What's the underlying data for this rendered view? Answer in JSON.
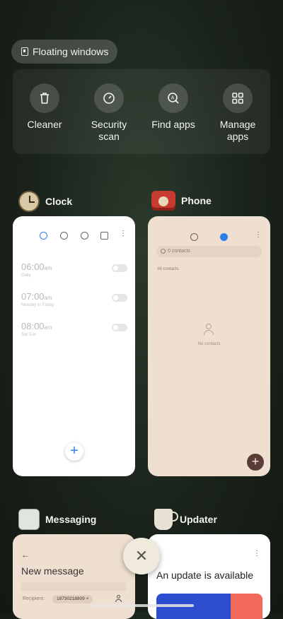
{
  "floating_windows": {
    "label": "Floating windows"
  },
  "quick_actions": [
    {
      "label": "Cleaner",
      "icon": "trash-icon"
    },
    {
      "label": "Security\nscan",
      "icon": "shield-check-icon"
    },
    {
      "label": "Find apps",
      "icon": "search-app-icon"
    },
    {
      "label": "Manage\napps",
      "icon": "grid-icon"
    }
  ],
  "apps": {
    "clock": {
      "name": "Clock",
      "alarms": [
        {
          "time": "06:00",
          "ampm": "am",
          "repeat": "Daily"
        },
        {
          "time": "07:00",
          "ampm": "am",
          "repeat": "Monday to Friday"
        },
        {
          "time": "08:00",
          "ampm": "am",
          "repeat": "Sat Sun"
        }
      ],
      "fab": "+"
    },
    "phone": {
      "name": "Phone",
      "search_placeholder": "0 contacts",
      "section": "All contacts",
      "empty_text": "No contacts",
      "fab": "+"
    },
    "messaging": {
      "name": "Messaging",
      "back": "←",
      "title": "New message",
      "recipient_label": "Recipient:",
      "recipient_chip": "18730218809 ×"
    },
    "updater": {
      "name": "Updater",
      "menu": "⋮",
      "title": "An update is available"
    }
  },
  "close_all": {
    "symbol": "✕"
  },
  "colors": {
    "clock_accent": "#2b7de9",
    "phone_card_bg": "#efdfd0",
    "phone_fab": "#5a3d36"
  }
}
